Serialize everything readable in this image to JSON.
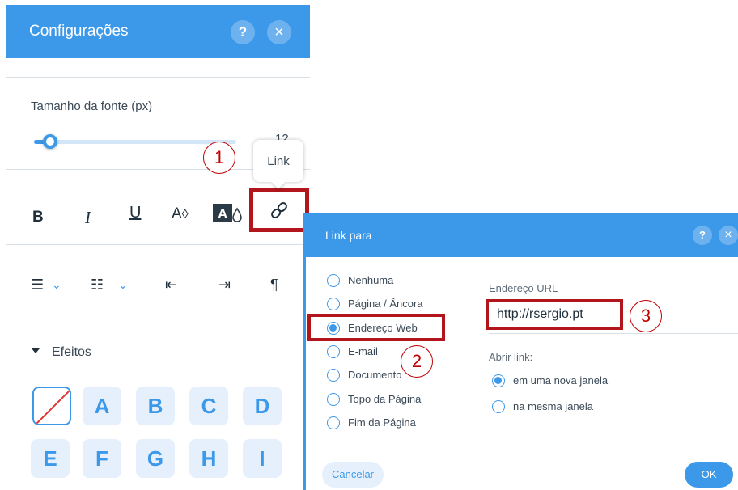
{
  "settings": {
    "title": "Configurações",
    "help": "?",
    "close": "×",
    "font_size_label": "Tamanho da fonte (px)",
    "font_size_value": "12",
    "tooltip": "Link",
    "format": {
      "bold": "B",
      "italic": "I",
      "underline": "U",
      "color": "A",
      "color_drop": "◊"
    },
    "effects_label": "Efeitos",
    "effects_row1": [
      "A",
      "B",
      "C",
      "D"
    ],
    "effects_row2": [
      "E",
      "F",
      "G",
      "H",
      "I"
    ]
  },
  "annotations": [
    "1",
    "2",
    "3"
  ],
  "dialog": {
    "title": "Link para",
    "help": "?",
    "close": "×",
    "options": [
      "Nenhuma",
      "Página / Âncora",
      "Endereço Web",
      "E-mail",
      "Documento",
      "Topo da Página",
      "Fim da Página"
    ],
    "selected_option": "Endereço Web",
    "url_label": "Endereço URL",
    "url_value": "http://rsergio.pt",
    "open_label": "Abrir link:",
    "open_options": [
      "em uma nova janela",
      "na mesma janela"
    ],
    "selected_open": "em uma nova janela",
    "cancel": "Cancelar",
    "ok": "OK"
  },
  "colors": {
    "accent": "#3c99e9",
    "annotation": "#b3151d",
    "effect_bg": "#e5f0fc"
  }
}
